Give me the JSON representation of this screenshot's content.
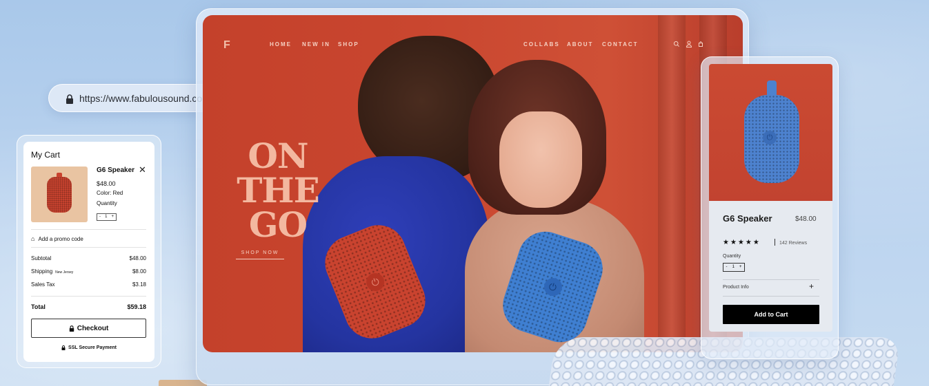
{
  "url_bar": {
    "url": "https://www.fabulousound.com"
  },
  "site": {
    "logo": "F",
    "nav_left": [
      "HOME",
      "NEW IN",
      "SHOP"
    ],
    "nav_right": [
      "COLLABS",
      "ABOUT",
      "CONTACT"
    ],
    "icons": [
      "search-icon",
      "user-icon",
      "bag-icon"
    ],
    "hero": {
      "title_lines": [
        "ON",
        "THE",
        "GO"
      ],
      "cta": "SHOP NOW"
    }
  },
  "cart": {
    "title": "My Cart",
    "item": {
      "name": "G6 Speaker",
      "price": "$48.00",
      "color": "Color: Red",
      "quantity_label": "Quantity",
      "quantity": "1",
      "minus": "-",
      "plus": "+"
    },
    "promo": "Add a promo code",
    "summary": {
      "subtotal_label": "Subtotal",
      "subtotal": "$48.00",
      "shipping_label": "Shipping",
      "shipping_region": "New Jersey",
      "shipping": "$8.00",
      "tax_label": "Sales Tax",
      "tax": "$3.18",
      "total_label": "Total",
      "total": "$59.18"
    },
    "checkout": "Checkout",
    "secure": "SSL Secure Payment"
  },
  "product": {
    "name": "G6 Speaker",
    "price": "$48.00",
    "rating_stars": 5,
    "stars": "★★★★★",
    "reviews": "142 Reviews",
    "quantity_label": "Quantity",
    "quantity": "1",
    "minus": "-",
    "plus": "+",
    "info_label": "Product Info",
    "info_toggle": "+",
    "add_to_cart": "Add to Cart"
  },
  "colors": {
    "brand_red": "#c9432f",
    "speaker_blue": "#4d82cf",
    "hero_text": "#f3b8a0"
  }
}
